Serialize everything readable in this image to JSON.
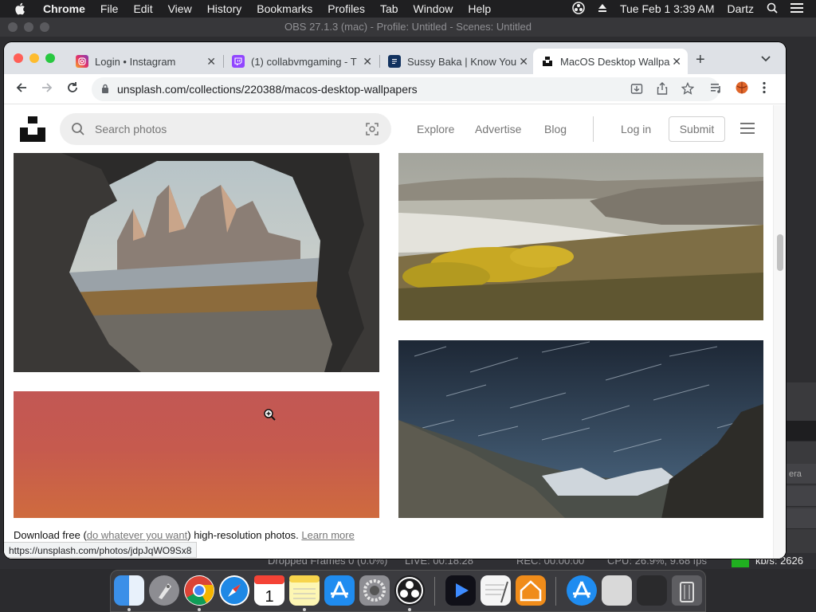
{
  "menubar": {
    "items": [
      "Chrome",
      "File",
      "Edit",
      "View",
      "History",
      "Bookmarks",
      "Profiles",
      "Tab",
      "Window",
      "Help"
    ],
    "clock": "Tue Feb 1  3:39 AM",
    "user": "Dartz"
  },
  "obs": {
    "title": "OBS 27.1.3 (mac) - Profile: Untitled - Scenes: Untitled",
    "status": {
      "dropped": "Dropped Frames 0 (0.0%)",
      "live": "LIVE: 00:18:28",
      "rec": "REC: 00:00:00",
      "cpu": "CPU: 26.9%, 9.68 fps",
      "kbs": "kb/s: 2626"
    },
    "side_label": "era"
  },
  "browser": {
    "tabs": [
      {
        "title": "Login • Instagram",
        "favicon": "instagram-icon",
        "color": "#e1306c"
      },
      {
        "title": "(1) collabvmgaming - T",
        "favicon": "twitch-icon",
        "color": "#9146ff"
      },
      {
        "title": "Sussy Baka | Know You",
        "favicon": "kym-icon",
        "color": "#12325f"
      },
      {
        "title": "MacOS Desktop Wallpa",
        "favicon": "unsplash-icon",
        "color": "#111111"
      }
    ],
    "url": "unsplash.com/collections/220388/macos-desktop-wallpapers"
  },
  "unsplash": {
    "search_placeholder": "Search photos",
    "nav": {
      "explore": "Explore",
      "advertise": "Advertise",
      "blog": "Blog",
      "login": "Log in",
      "submit": "Submit"
    },
    "banner": {
      "prefix": "Download free (",
      "link": "do whatever you want",
      "middle": ") high-resolution photos.",
      "learn": "Learn more"
    },
    "hover_url": "https://unsplash.com/photos/jdpJqWO9Sx8"
  },
  "colors": {
    "accent_blue": "#1a73e8",
    "mac_red": "#ff5f57",
    "mac_yellow": "#febc2e",
    "mac_green": "#28c840"
  }
}
